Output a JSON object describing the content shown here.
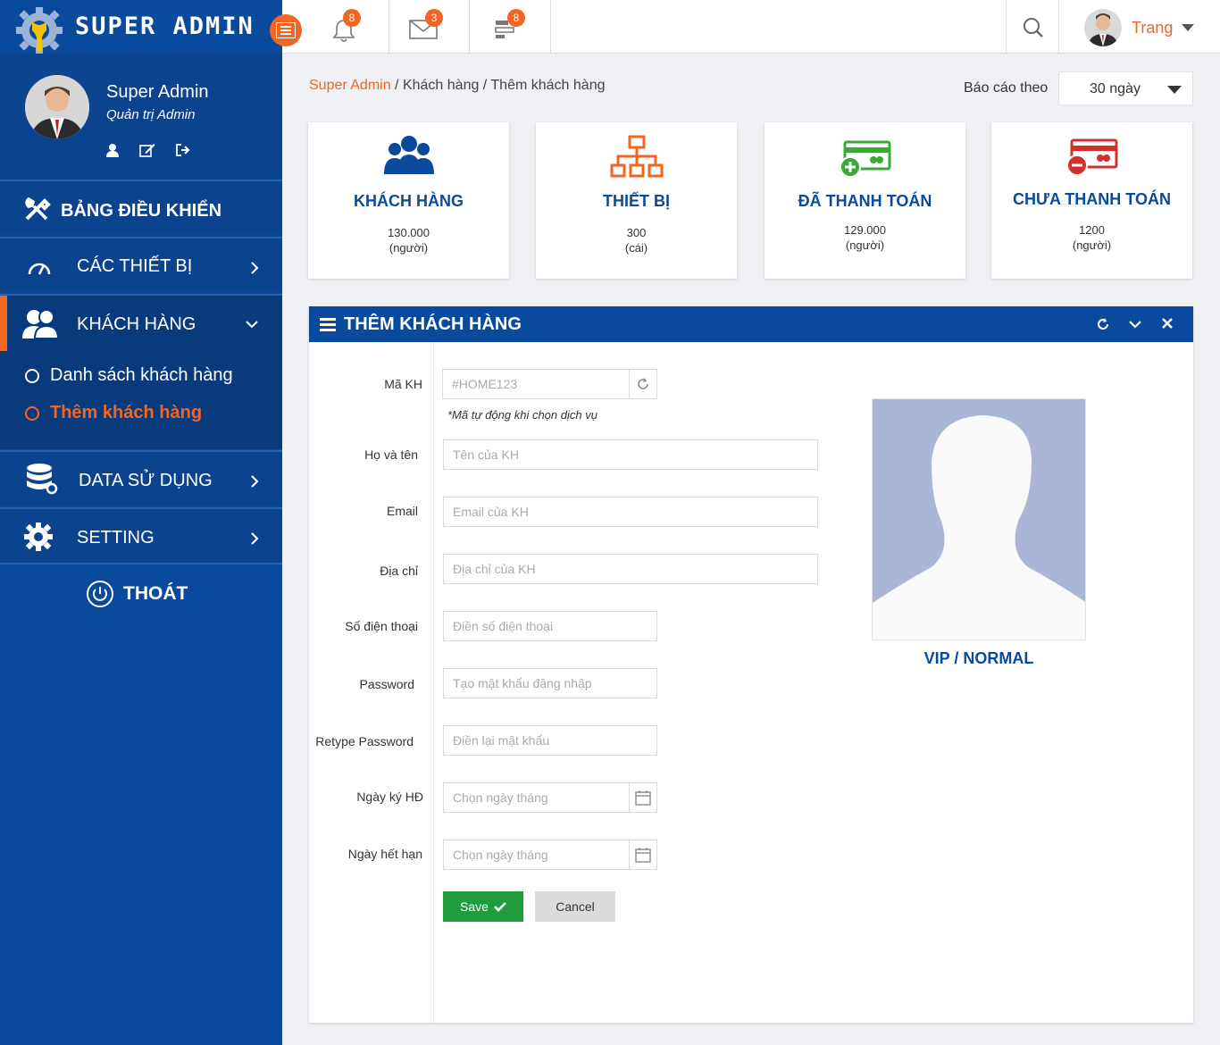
{
  "brand": {
    "title": "SUPER ADMIN"
  },
  "topbar": {
    "notifications_count": "8",
    "messages_count": "3",
    "tasks_count": "8",
    "user_name": "Trang"
  },
  "sidebar": {
    "profile": {
      "name": "Super Admin",
      "role": "Quản trị Admin"
    },
    "dashboard_label": "BẢNG ĐIỀU KHIỂN",
    "items": [
      {
        "label": "CÁC THIẾT BỊ"
      },
      {
        "label": "KHÁCH HÀNG"
      },
      {
        "label": "DATA SỬ DỤNG"
      },
      {
        "label": "SETTING"
      }
    ],
    "submenu": [
      {
        "label": "Danh sách khách hàng"
      },
      {
        "label": "Thêm khách hàng"
      }
    ],
    "logout_label": "THOÁT"
  },
  "breadcrumb": {
    "home": "Super Admin",
    "sep1": " / ",
    "section": "Khách hàng",
    "sep2": " / ",
    "current": "Thêm khách hàng"
  },
  "report": {
    "label": "Báo cáo theo",
    "selected": "30 ngày"
  },
  "stats": [
    {
      "title": "KHÁCH HÀNG",
      "value": "130.000",
      "unit": "(người)"
    },
    {
      "title": "THIẾT BỊ",
      "value": "300",
      "unit": "(cái)"
    },
    {
      "title": "ĐÃ THANH TOÁN",
      "value": "129.000",
      "unit": "(người)"
    },
    {
      "title": "CHƯA THANH TOÁN",
      "value": "1200",
      "unit": "(người)"
    }
  ],
  "form": {
    "title": "THÊM KHÁCH HÀNG",
    "fields": {
      "code": {
        "label": "Mã KH",
        "placeholder": "#HOME123",
        "hint": "*Mã tự động khi chọn dịch vụ"
      },
      "name": {
        "label": "Họ và tên",
        "placeholder": "Tên của KH"
      },
      "email": {
        "label": "Email",
        "placeholder": "Email của KH"
      },
      "address": {
        "label": "Địa chỉ",
        "placeholder": "Địa chỉ của KH"
      },
      "phone": {
        "label": "Số điện thoại",
        "placeholder": "Điền số điện thoại"
      },
      "password": {
        "label": "Password",
        "placeholder": "Tạo mật khẩu đăng nhập"
      },
      "retype": {
        "label": "Retype Password",
        "placeholder": "Điền lại mật khẩu"
      },
      "sign_date": {
        "label": "Ngày ký HĐ",
        "placeholder": "Chọn ngày tháng"
      },
      "expire_date": {
        "label": "Ngày hết hạn",
        "placeholder": "Chọn ngày tháng"
      }
    },
    "save_label": "Save",
    "cancel_label": "Cancel",
    "membership_label": "VIP / NORMAL"
  },
  "colors": {
    "primary": "#0a4a9c",
    "accent": "#f26522",
    "success": "#1f9c3c",
    "danger": "#d32f2f",
    "green_icon": "#3aaa35"
  }
}
